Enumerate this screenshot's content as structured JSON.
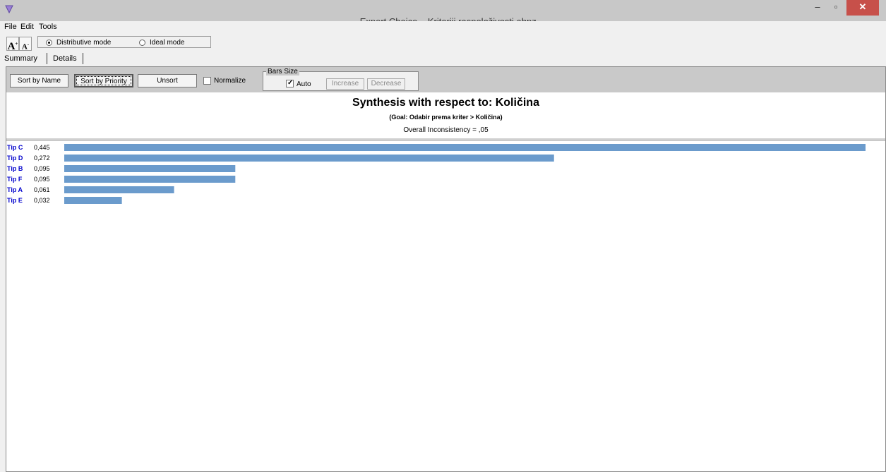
{
  "window": {
    "app_name": "Expert Choice",
    "file_name": "Kriteriji raspoloživosti.ahpz",
    "minimize": "–",
    "restore": "▫",
    "close": "✕"
  },
  "menu": [
    "File",
    "Edit",
    "Tools"
  ],
  "toolbar": {
    "font_increase": "A",
    "font_decrease": "A",
    "modes": [
      {
        "label": "Distributive mode",
        "selected": true
      },
      {
        "label": "Ideal mode",
        "selected": false
      }
    ]
  },
  "tabs": [
    "Summary",
    "Details"
  ],
  "controls": {
    "sort_by_name": "Sort by Name",
    "sort_by_priority": "Sort by Priority",
    "unsort": "Unsort",
    "normalize": "Normalize",
    "normalize_checked": false,
    "bars_size": "Bars Size",
    "auto": "Auto",
    "auto_checked": true,
    "increase": "Increase",
    "decrease": "Decrease"
  },
  "synthesis": {
    "title": "Synthesis with respect to: Količina",
    "goal": "(Goal: Odabir prema kriter > Količina)",
    "inconsistency": "Overall Inconsistency = ,05"
  },
  "colors": {
    "bar": "#6b9bcc",
    "label": "#0000cc",
    "close": "#c7504a"
  },
  "chart_data": {
    "type": "bar",
    "orientation": "horizontal",
    "categories": [
      "Tip C",
      "Tip D",
      "Tip B",
      "Tip F",
      "Tip A",
      "Tip E"
    ],
    "values": [
      0.445,
      0.272,
      0.095,
      0.095,
      0.061,
      0.032
    ],
    "value_labels": [
      "0,445",
      "0,272",
      "0,095",
      "0,095",
      "0,061",
      "0,032"
    ]
  }
}
